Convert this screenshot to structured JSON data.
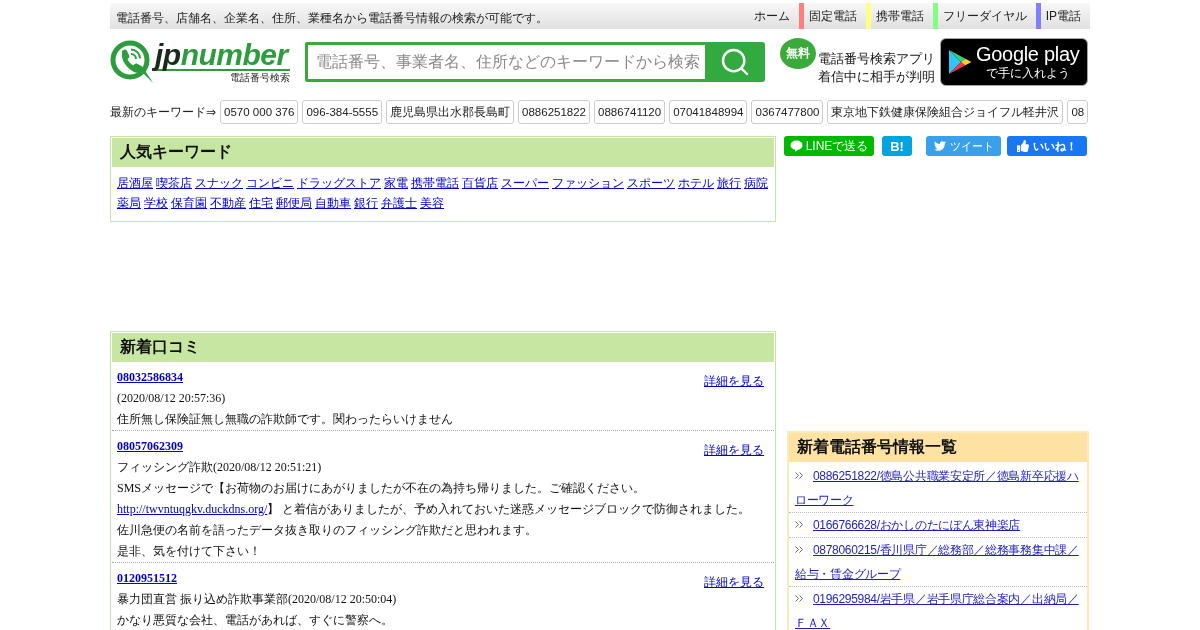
{
  "top_bar": {
    "tagline": "電話番号、店舗名、企業名、住所、業種名から電話番号情報の検索が可能です。",
    "nav": [
      {
        "label": "ホーム"
      },
      {
        "label": "固定電話",
        "color": "#ff7f7f"
      },
      {
        "label": "携帯電話",
        "color": "#ffff80"
      },
      {
        "label": "フリーダイヤル",
        "color": "#80ff80"
      },
      {
        "label": "IP電話",
        "color": "#8080ff"
      }
    ]
  },
  "header": {
    "logo": {
      "wordmark_dark": "jp",
      "wordmark_green": "number",
      "tagline": "電話番号検索"
    },
    "search": {
      "placeholder": "電話番号、事業者名、住所などのキーワードから検索"
    },
    "app_promo": {
      "badge": "無料",
      "lines": [
        "電話番号検索アプリ",
        "着信中に相手が判明"
      ]
    },
    "store_badge": {
      "title": "Google play",
      "subtitle": "で手に入れよう"
    }
  },
  "latest_keywords": {
    "label": "最新のキーワード⇒",
    "items": [
      "0570 000 376",
      "096-384-5555",
      "鹿児島県出水郡長島町",
      "0886251822",
      "0886741120",
      "07041848994",
      "0367477800",
      "東京地下鉄健康保険組合ジョイフル軽井沢",
      "08"
    ]
  },
  "popular_keywords": {
    "title": "人気キーワード",
    "items": [
      "居酒屋",
      "喫茶店",
      "スナック",
      "コンビニ",
      "ドラッグストア",
      "家電",
      "携帯電話",
      "百貨店",
      "スーパー",
      "ファッション",
      "スポーツ",
      "ホテル",
      "旅行",
      "病院",
      "薬局",
      "学校",
      "保育園",
      "不動産",
      "住宅",
      "郵便局",
      "自動車",
      "銀行",
      "弁護士",
      "美容"
    ]
  },
  "share_buttons": [
    {
      "kind": "line",
      "label": "LINEで送る"
    },
    {
      "kind": "hatena",
      "label": "B!"
    },
    {
      "kind": "twitter",
      "label": "ツイート"
    },
    {
      "kind": "facebook",
      "label": "いいね！"
    }
  ],
  "reviews": {
    "title": "新着口コミ",
    "items": [
      {
        "number": "08032586834",
        "detail_link": "詳細を見る",
        "heading": "(2020/08/12 20:57:36)",
        "lines": [
          {
            "text": "住所無し保険証無し無職の詐欺師です。関わったらいけません"
          }
        ]
      },
      {
        "number": "08057062309",
        "detail_link": "詳細を見る",
        "heading": "フィッシング詐欺(2020/08/12 20:51:21)",
        "lines": [
          {
            "text": "SMSメッセージで【お荷物のお届けにあがりましたが不在の為持ち帰りました。ご確認ください。"
          },
          {
            "link": "http://twvntuqgkv.duckdns.org/",
            "text": "】 と着信がありましたが、予め入れておいた迷惑メッセージブロックで防御されました。"
          },
          {
            "text": "佐川急便の名前を語ったデータ抜き取りのフィッシング詐欺だと思われます。"
          },
          {
            "text": "是非、気を付けて下さい！"
          }
        ]
      },
      {
        "number": "0120951512",
        "detail_link": "詳細を見る",
        "heading": "暴力団直営 振り込め詐欺事業部(2020/08/12 20:50:04)",
        "lines": [
          {
            "text": "かなり悪質な会社、電話があれば、すぐに警察へ。"
          }
        ]
      }
    ]
  },
  "new_numbers": {
    "title": "新着電話番号情報一覧",
    "items": [
      "0886251822/徳島公共職業安定所／徳島新卒応援ハローワーク",
      "0166766628/おかしのたにぽん東神楽店",
      "0878060215/香川県庁／総務部／総務事務集中課／給与・賃金グループ",
      "0196295984/岩手県／岩手県庁総合案内／出納局／ＦＡＸ"
    ]
  }
}
